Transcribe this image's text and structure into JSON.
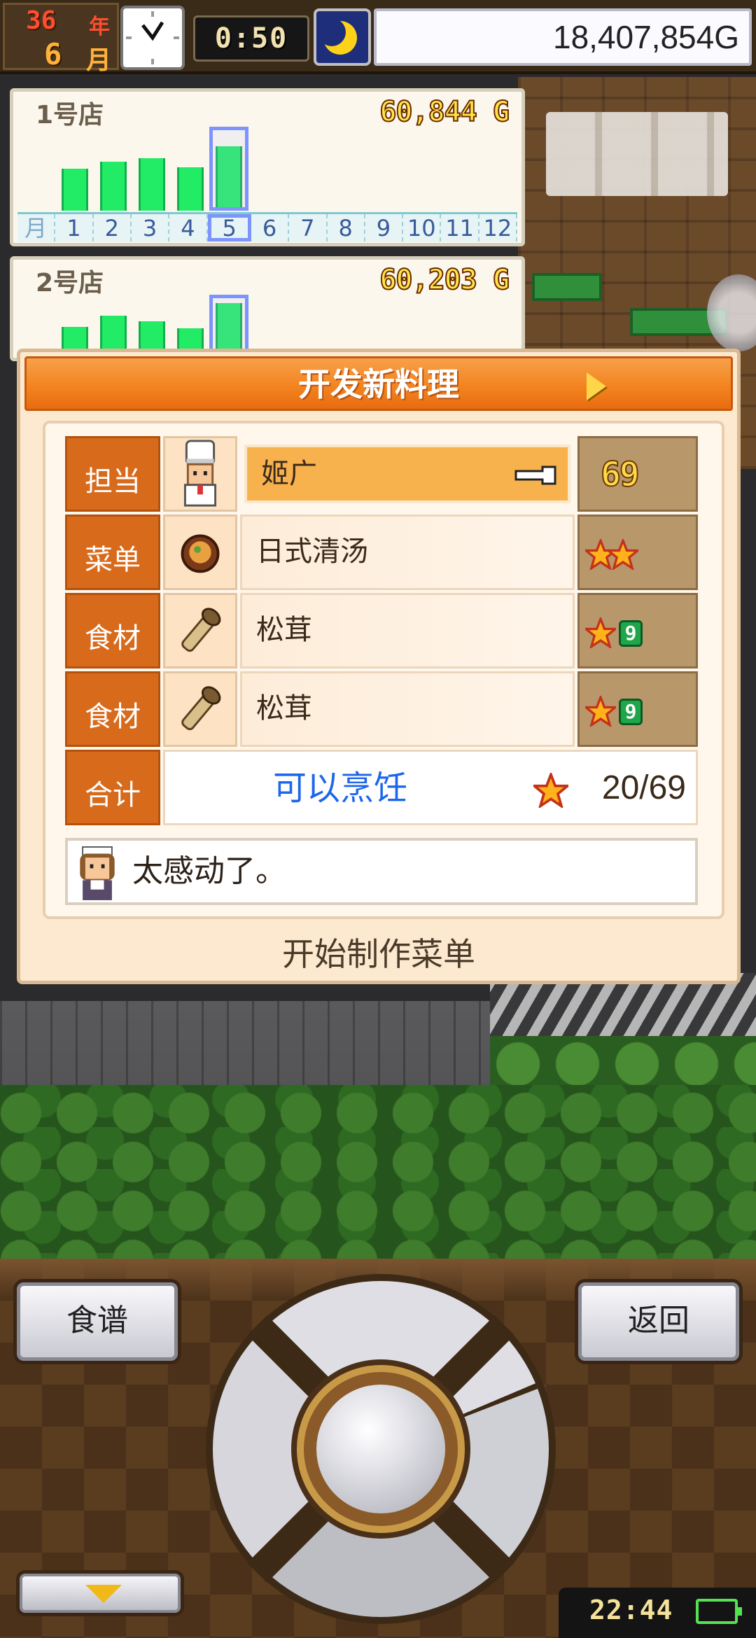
{
  "top_bar": {
    "year": "36",
    "year_unit": "年",
    "month": "6",
    "month_unit": "月",
    "game_time": "0:50",
    "money": "18,407,854G",
    "clock_icon": "clock-icon",
    "night_icon": "moon-icon"
  },
  "stores": [
    {
      "name": "1号店",
      "sales": "60,844 G",
      "month_unit": "月",
      "months": [
        "1",
        "2",
        "3",
        "4",
        "5",
        "6",
        "7",
        "8",
        "9",
        "10",
        "11",
        "12"
      ],
      "selected_month": "5",
      "bar_levels": [
        0.6,
        0.7,
        0.75,
        0.62,
        0.92
      ]
    },
    {
      "name": "2号店",
      "sales": "60,203 G",
      "bar_levels": [
        0.58,
        0.74,
        0.66,
        0.56,
        0.92
      ]
    }
  ],
  "dialog": {
    "title": "开发新料理",
    "rows": [
      {
        "label": "担当",
        "icon": "chef-icon",
        "value": "姬广",
        "rating_text": "69",
        "pointer_icon": "hand-pointer-icon"
      },
      {
        "label": "菜单",
        "icon": "soup-bowl-icon",
        "value": "日式清汤",
        "stars": 2
      },
      {
        "label": "食材",
        "icon": "matsutake-icon",
        "value": "松茸",
        "stars": 1,
        "badge": "9"
      },
      {
        "label": "食材",
        "icon": "matsutake-icon",
        "value": "松茸",
        "stars": 1,
        "badge": "9"
      }
    ],
    "total": {
      "label": "合计",
      "status": "可以烹饪",
      "score": "20/69"
    },
    "comment": {
      "avatar": "waitress-avatar-icon",
      "text": "太感动了。"
    },
    "start_button": "开始制作菜单"
  },
  "controls": {
    "recipe_button": "食谱",
    "back_button": "返回",
    "status_time": "22:44"
  },
  "colors": {
    "header_orange": "#f38420",
    "label_orange": "#d86a1c",
    "bar_green": "#22ec66",
    "status_blue": "#1e66ea",
    "panel_cream": "#fde9cf"
  }
}
